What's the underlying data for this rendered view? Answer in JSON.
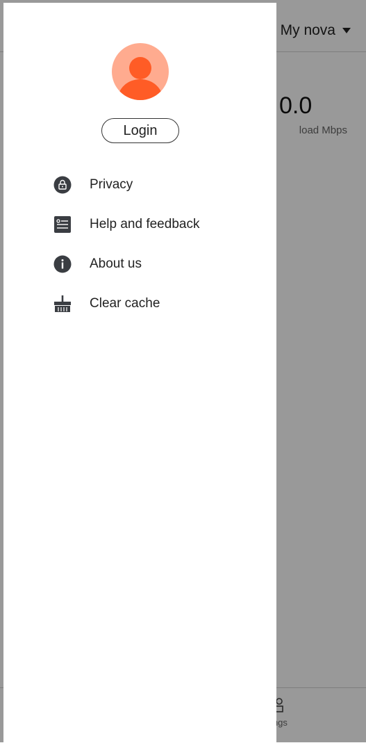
{
  "background": {
    "network_selector": "My nova",
    "speed_value": "0.0",
    "speed_label": "load Mbps",
    "bottom_nav_label": "ings"
  },
  "drawer": {
    "login_label": "Login",
    "menu": [
      {
        "label": "Privacy",
        "icon": "lock-icon"
      },
      {
        "label": "Help and feedback",
        "icon": "feedback-icon"
      },
      {
        "label": "About us",
        "icon": "info-icon"
      },
      {
        "label": "Clear cache",
        "icon": "broom-icon"
      }
    ]
  },
  "colors": {
    "avatar_bg": "#ffab8f",
    "avatar_fg": "#ff5c26",
    "icon": "#3a3d42",
    "scrim": "rgba(0,0,0,0.40)"
  }
}
